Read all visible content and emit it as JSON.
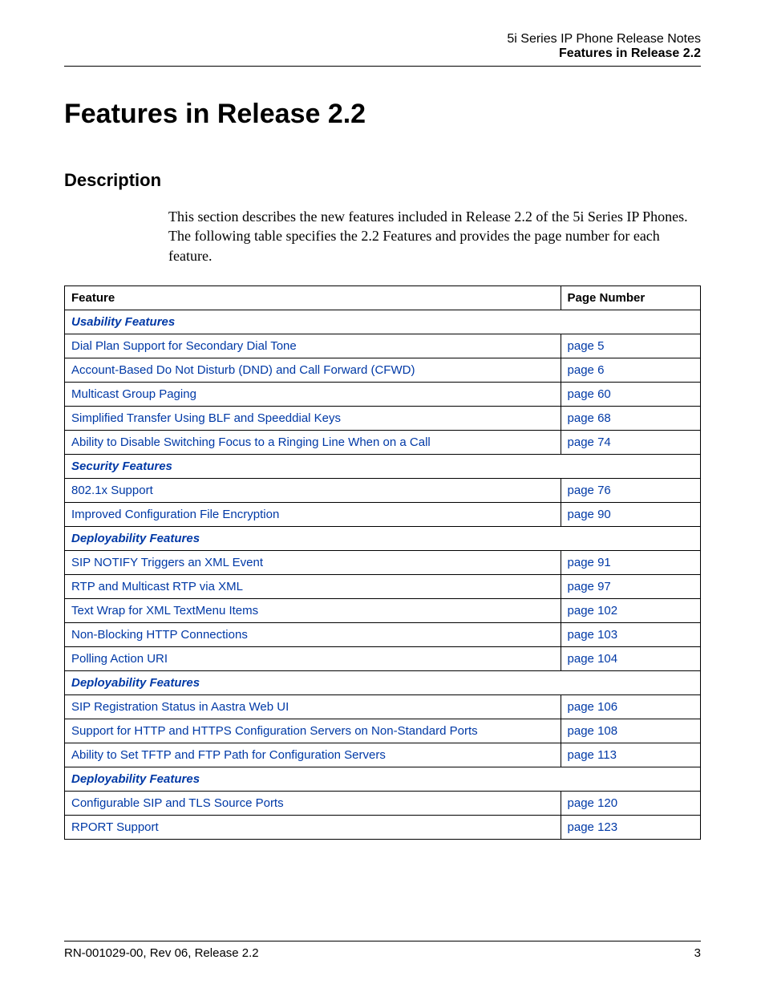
{
  "header": {
    "line1": "5i Series IP Phone Release Notes",
    "line2": "Features in Release 2.2"
  },
  "title": "Features in Release 2.2",
  "section_heading": "Description",
  "intro_paragraph": "This section describes the new features included in Release 2.2 of the 5i Series IP Phones. The following table specifies the 2.2 Features and provides the page number for each feature.",
  "table": {
    "headers": {
      "feature": "Feature",
      "page": "Page Number"
    },
    "rows": [
      {
        "type": "section",
        "label": "Usability Features"
      },
      {
        "type": "item",
        "feature": "Dial Plan Support for Secondary Dial Tone",
        "page": "page 5"
      },
      {
        "type": "item",
        "feature": "Account-Based Do Not Disturb (DND) and Call Forward (CFWD)",
        "page": "page 6"
      },
      {
        "type": "item",
        "feature": "Multicast Group Paging",
        "page": "page 60"
      },
      {
        "type": "item",
        "feature": "Simplified Transfer Using BLF and Speeddial Keys",
        "page": "page 68"
      },
      {
        "type": "item",
        "feature": "Ability to Disable Switching Focus to a Ringing Line When on a Call",
        "page": "page 74"
      },
      {
        "type": "section",
        "label": "Security Features"
      },
      {
        "type": "item",
        "feature": "802.1x Support",
        "page": "page 76"
      },
      {
        "type": "item",
        "feature": "Improved Configuration File Encryption",
        "page": "page 90"
      },
      {
        "type": "section",
        "label": "Deployability Features"
      },
      {
        "type": "item",
        "feature": "SIP NOTIFY Triggers an XML Event",
        "page": "page 91"
      },
      {
        "type": "item",
        "feature": "RTP and Multicast RTP via XML",
        "page": "page 97"
      },
      {
        "type": "item",
        "feature": "Text Wrap for XML TextMenu Items",
        "page": "page 102"
      },
      {
        "type": "item",
        "feature": "Non-Blocking HTTP Connections",
        "page": "page 103"
      },
      {
        "type": "item",
        "feature": "Polling Action URI",
        "page": "page 104"
      },
      {
        "type": "section",
        "label": "Deployability Features"
      },
      {
        "type": "item",
        "feature": "SIP Registration Status in Aastra Web UI",
        "page": "page 106"
      },
      {
        "type": "item",
        "feature": "Support for HTTP and HTTPS Configuration Servers on Non-Standard Ports",
        "page": "page 108"
      },
      {
        "type": "item",
        "feature": "Ability to Set TFTP and FTP Path for Configuration Servers",
        "page": "page 113"
      },
      {
        "type": "section",
        "label": "Deployability Features"
      },
      {
        "type": "item",
        "feature": "Configurable SIP and TLS Source Ports",
        "page": "page 120"
      },
      {
        "type": "item",
        "feature": "RPORT Support",
        "page": "page 123"
      }
    ]
  },
  "footer": {
    "left": "RN-001029-00, Rev 06, Release 2.2",
    "right": "3"
  }
}
